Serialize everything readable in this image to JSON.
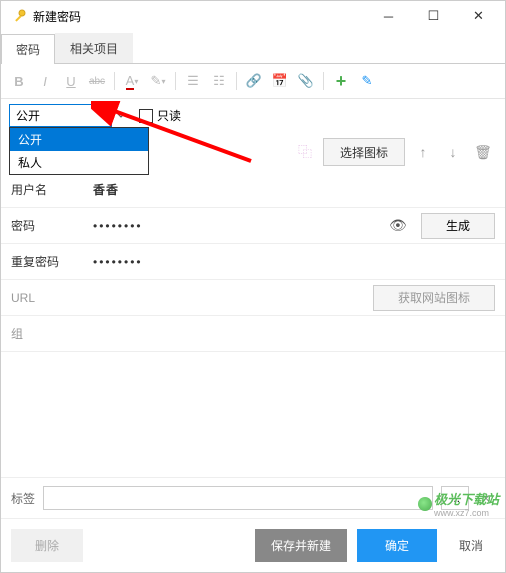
{
  "window": {
    "title": "新建密码"
  },
  "tabs": {
    "password": "密码",
    "related": "相关项目"
  },
  "toolbar": {
    "bold": "B",
    "italic": "I",
    "underline": "U",
    "strike": "abc"
  },
  "visibility": {
    "value": "公开",
    "options": [
      "公开",
      "私人"
    ],
    "readonly_label": "只读"
  },
  "iconrow": {
    "select_icon": "选择图标"
  },
  "form": {
    "username_label": "用户名",
    "username_value": "香香",
    "password_label": "密码",
    "password_value": "••••••••",
    "generate": "生成",
    "repeat_label": "重复密码",
    "repeat_value": "••••••••",
    "url_label": "URL",
    "get_site_icon": "获取网站图标",
    "group_label": "组"
  },
  "tags": {
    "label": "标签",
    "more": "..."
  },
  "footer": {
    "delete": "删除",
    "save_new": "保存并新建",
    "ok": "确定",
    "cancel": "取消"
  },
  "watermark": {
    "text": "极光下载站",
    "url": "www.xz7.com"
  }
}
